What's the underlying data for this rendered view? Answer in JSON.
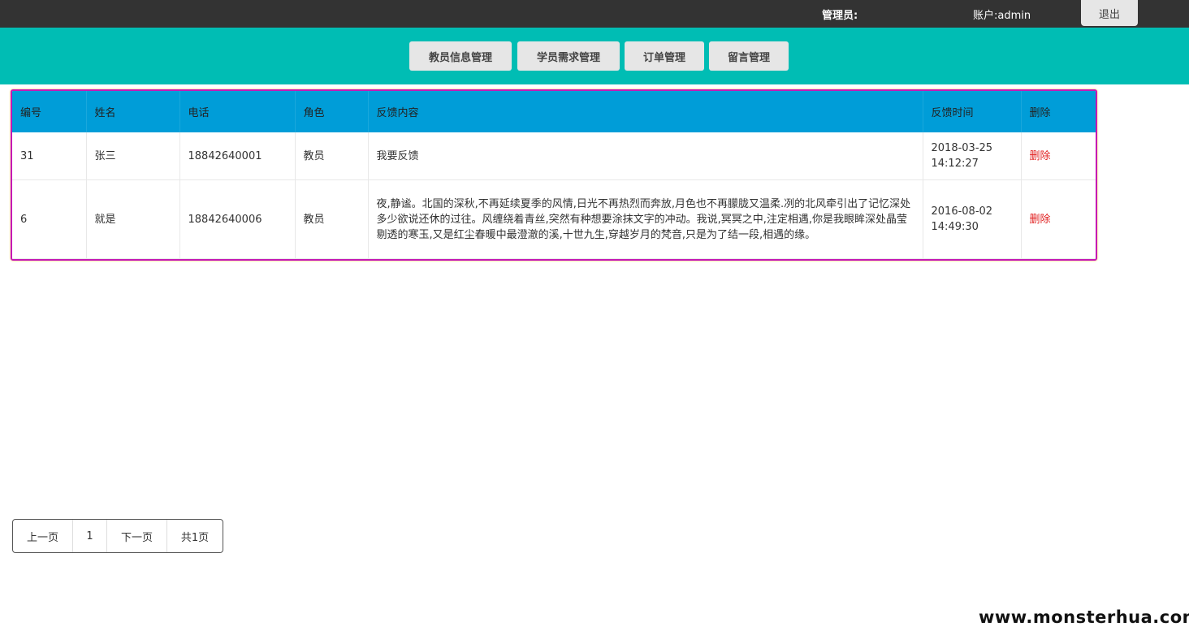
{
  "header": {
    "admin_label": "管理员:",
    "account_label": "账户:admin",
    "logout_label": "退出"
  },
  "nav": {
    "items": [
      "教员信息管理",
      "学员需求管理",
      "订单管理",
      "留言管理"
    ]
  },
  "table": {
    "columns": [
      "编号",
      "姓名",
      "电话",
      "角色",
      "反馈内容",
      "反馈时间",
      "删除"
    ],
    "rows": [
      {
        "id": "31",
        "name": "张三",
        "phone": "18842640001",
        "role": "教员",
        "content": "我要反馈",
        "time": "2018-03-25 14:12:27",
        "delete": "删除"
      },
      {
        "id": "6",
        "name": "就是",
        "phone": "18842640006",
        "role": "教员",
        "content": "夜,静谧。北国的深秋,不再延续夏季的风情,日光不再热烈而奔放,月色也不再朦胧又温柔.冽的北风牵引出了记忆深处多少欲说还休的过往。风缠绕着青丝,突然有种想要涂抹文字的冲动。我说,冥冥之中,注定相遇,你是我眼眸深处晶莹剔透的寒玉,又是红尘春暖中最澄澈的溪,十世九生,穿越岁月的梵音,只是为了结一段,相遇的缘。",
        "time": "2016-08-02 14:49:30",
        "delete": "删除"
      }
    ]
  },
  "pagination": {
    "prev": "上一页",
    "current": "1",
    "next": "下一页",
    "total": "共1页"
  },
  "watermark": "www.monsterhua.com",
  "colors": {
    "topbar": "#333333",
    "navbar": "#00bdb4",
    "table_header": "#009dd8",
    "delete_link": "#e02020",
    "table_border": "#c519b5"
  }
}
